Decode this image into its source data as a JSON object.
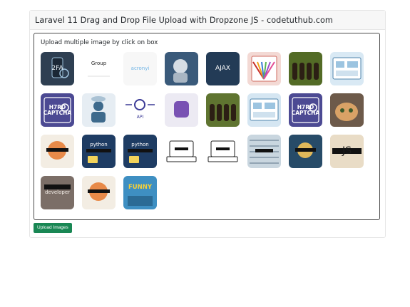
{
  "card": {
    "title": "Laravel 11 Drag and Drop File Upload with Dropzone JS - codetuthub.com"
  },
  "dropzone": {
    "message": "Upload multiple image by click on box"
  },
  "thumbnails": [
    {
      "name": "thumb-2fa-phone",
      "label": "2FA",
      "bg": "#2e3f52",
      "fg": "#e8f1f8"
    },
    {
      "name": "thumb-group-sql",
      "label": "Group",
      "bg": "#ffffff",
      "fg": "#222222"
    },
    {
      "name": "thumb-acronym",
      "label": "acronyi",
      "bg": "#f7f7f7",
      "fg": "#6fb4e6"
    },
    {
      "name": "thumb-ai-face",
      "label": "",
      "bg": "#3a5a7a",
      "fg": "#cfe6f5"
    },
    {
      "name": "thumb-ajax",
      "label": "AJAX",
      "bg": "#233b56",
      "fg": "#ffffff"
    },
    {
      "name": "thumb-browser-fan",
      "label": "",
      "bg": "#f3d9d4",
      "fg": "#c8302a"
    },
    {
      "name": "thumb-forest-people",
      "label": "",
      "bg": "#536b26",
      "fg": "#d0c47a"
    },
    {
      "name": "thumb-dashboard-sketch",
      "label": "",
      "bg": "#d9e9f4",
      "fg": "#4f85ad"
    },
    {
      "name": "thumb-captcha",
      "label": "H7RD CAPTCHA",
      "bg": "#4c4a93",
      "fg": "#ffffff"
    },
    {
      "name": "thumb-cloud-user",
      "label": "",
      "bg": "#e6edf3",
      "fg": "#3e6a8c"
    },
    {
      "name": "thumb-api-gear",
      "label": "API",
      "bg": "#ffffff",
      "fg": "#3b3a96"
    },
    {
      "name": "thumb-bootstrap",
      "label": "B",
      "bg": "#eceaf3",
      "fg": "#7952b3"
    },
    {
      "name": "thumb-forest-people-2",
      "label": "",
      "bg": "#5f7430",
      "fg": "#d0c47a"
    },
    {
      "name": "thumb-dashboard-sketch-2",
      "label": "",
      "bg": "#d5e6f2",
      "fg": "#4f85ad"
    },
    {
      "name": "thumb-captcha-2",
      "label": "H7RD CAPTCHA",
      "bg": "#4c4a93",
      "fg": "#ffffff"
    },
    {
      "name": "thumb-cat",
      "label": "",
      "bg": "#6d5a4a",
      "fg": "#e2b07a"
    },
    {
      "name": "thumb-cartoon-laptop",
      "label": "",
      "bg": "#f3ede3",
      "fg": "#d35a2e"
    },
    {
      "name": "thumb-python",
      "label": "python",
      "bg": "#1e3c63",
      "fg": "#ffffff"
    },
    {
      "name": "thumb-python-2",
      "label": "python",
      "bg": "#1e3c63",
      "fg": "#ffffff"
    },
    {
      "name": "thumb-laptop-sketch",
      "label": "",
      "bg": "#ffffff",
      "fg": "#222222"
    },
    {
      "name": "thumb-laptop-sketch-2",
      "label": "",
      "bg": "#ffffff",
      "fg": "#222222"
    },
    {
      "name": "thumb-circuit",
      "label": "",
      "bg": "#c9d6df",
      "fg": "#37516a"
    },
    {
      "name": "thumb-wizard",
      "label": "",
      "bg": "#274b68",
      "fg": "#e0b85a"
    },
    {
      "name": "thumb-js",
      "label": "JS",
      "bg": "#e9dcc6",
      "fg": "#1a1a1a"
    },
    {
      "name": "thumb-developer",
      "label": "developer",
      "bg": "#7b6e67",
      "fg": "#f2ece6"
    },
    {
      "name": "thumb-cartoon-laptop-2",
      "label": "",
      "bg": "#f3ede3",
      "fg": "#d35a2e"
    },
    {
      "name": "thumb-funny",
      "label": "FUNNY",
      "bg": "#3e8fc2",
      "fg": "#f4cf3a"
    }
  ],
  "actions": {
    "upload_label": "Upload Images"
  }
}
